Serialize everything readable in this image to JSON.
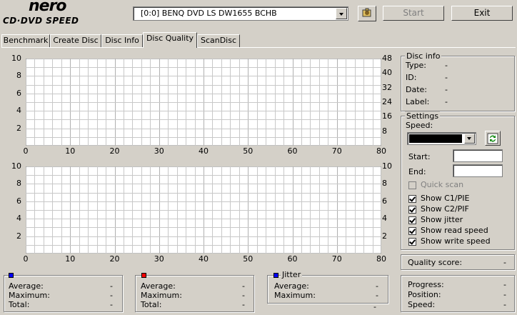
{
  "logo": {
    "line1": "nero",
    "line2": "CD·DVD SPEED"
  },
  "drive": {
    "selected": "[0:0]   BENQ DVD LS DW1655 BCHB"
  },
  "buttons": {
    "start": "Start",
    "exit": "Exit"
  },
  "tabs": [
    "Benchmark",
    "Create Disc",
    "Disc Info",
    "Disc Quality",
    "ScanDisc"
  ],
  "active_tab": "Disc Quality",
  "chart_top": {
    "left_ticks": [
      "10",
      "8",
      "6",
      "4",
      "2"
    ],
    "right_ticks": [
      "48",
      "40",
      "32",
      "24",
      "16",
      "8"
    ],
    "x_ticks": [
      "0",
      "10",
      "20",
      "30",
      "40",
      "50",
      "60",
      "70",
      "80"
    ]
  },
  "chart_bottom": {
    "left_ticks": [
      "10",
      "8",
      "6",
      "4",
      "2"
    ],
    "right_ticks": [
      "10",
      "8",
      "6",
      "4",
      "2"
    ],
    "x_ticks": [
      "0",
      "10",
      "20",
      "30",
      "40",
      "50",
      "60",
      "70",
      "80"
    ]
  },
  "chart_data": [
    {
      "type": "line",
      "series": [],
      "xlim": [
        0,
        80
      ],
      "ylim": [
        0,
        10
      ],
      "y2lim": [
        0,
        48
      ],
      "grid": true
    },
    {
      "type": "line",
      "series": [],
      "xlim": [
        0,
        80
      ],
      "ylim": [
        0,
        10
      ],
      "y2lim": [
        0,
        10
      ],
      "grid": true
    }
  ],
  "disc_info": {
    "title": "Disc info",
    "type_label": "Type:",
    "type_value": "-",
    "id_label": "ID:",
    "id_value": "-",
    "date_label": "Date:",
    "date_value": "-",
    "label_label": "Label:",
    "label_value": "-"
  },
  "settings": {
    "title": "Settings",
    "speed_label": "Speed:",
    "start_label": "Start:",
    "end_label": "End:",
    "quick_scan": "Quick scan",
    "show_c1": "Show C1/PIE",
    "show_c2": "Show C2/PIF",
    "show_jitter": "Show jitter",
    "show_read": "Show read speed",
    "show_write": "Show write speed"
  },
  "quality": {
    "label": "Quality score:",
    "value": "-"
  },
  "stats1": {
    "avg_label": "Average:",
    "avg": "-",
    "max_label": "Maximum:",
    "max": "-",
    "total_label": "Total:",
    "total": "-",
    "color": "#0000ff"
  },
  "stats2": {
    "avg_label": "Average:",
    "avg": "-",
    "max_label": "Maximum:",
    "max": "-",
    "total_label": "Total:",
    "total": "-",
    "color": "#ff0000"
  },
  "jitter": {
    "title": "Jitter",
    "avg_label": "Average:",
    "avg": "-",
    "max_label": "Maximum:",
    "max": "-",
    "extra": "-",
    "color": "#0000ff"
  },
  "progress": {
    "progress_label": "Progress:",
    "progress": "-",
    "position_label": "Position:",
    "position": "-",
    "speed_label": "Speed:",
    "speed": "-"
  }
}
